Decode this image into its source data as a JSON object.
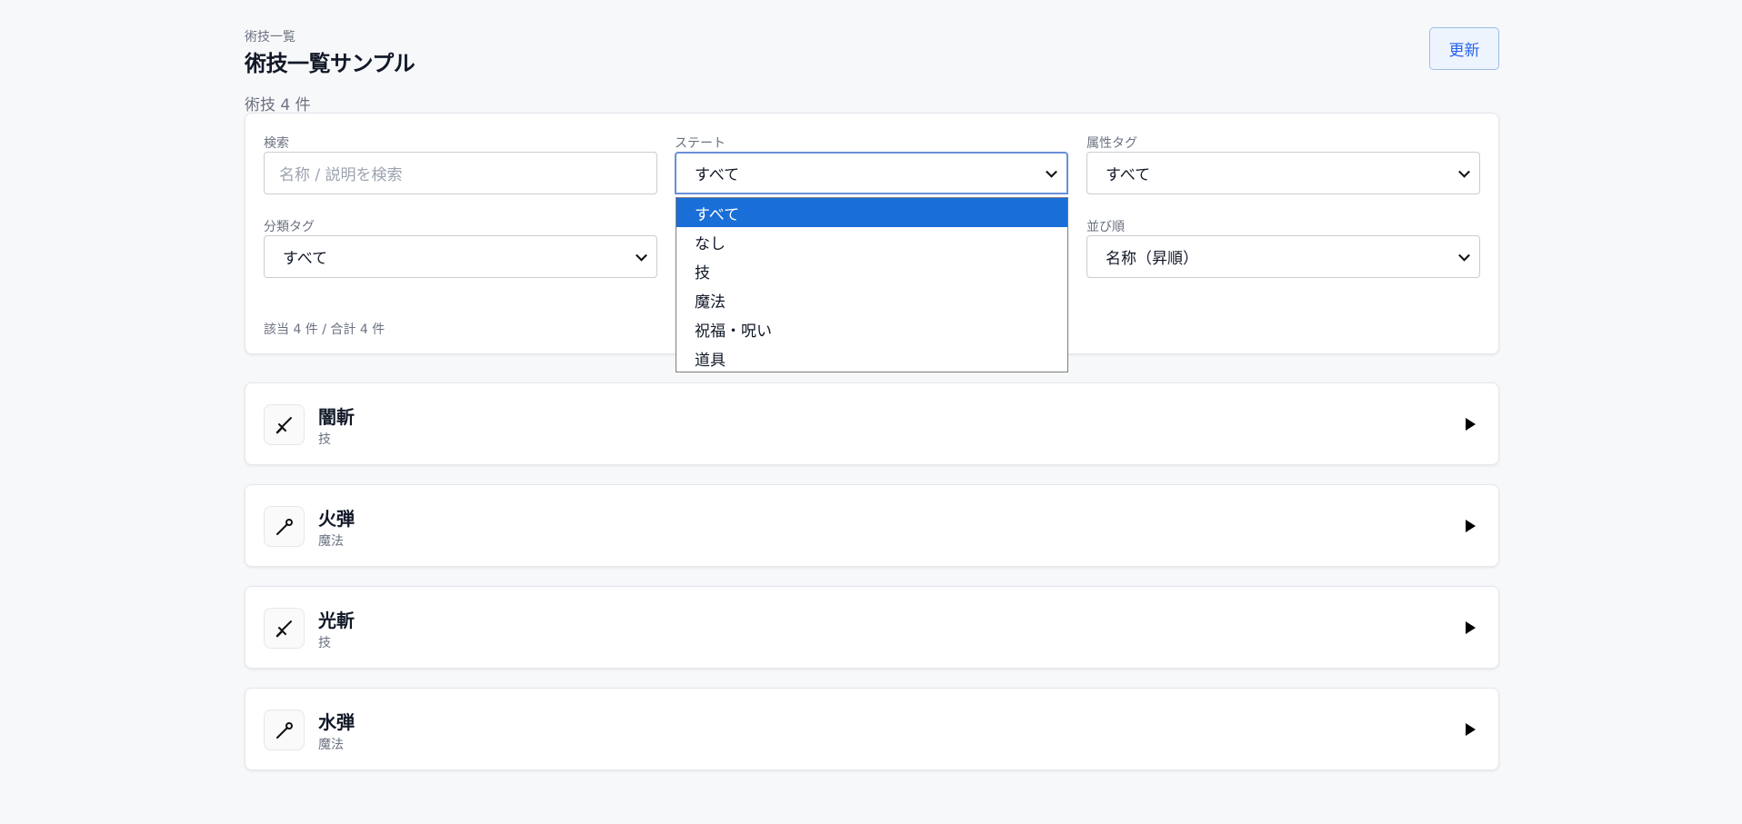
{
  "header": {
    "breadcrumb": "術技一覧",
    "title": "術技一覧サンプル",
    "refresh_label": "更新",
    "count_caption": "術技 4 件"
  },
  "filters": {
    "search": {
      "label": "検索",
      "placeholder": "名称 / 説明を検索",
      "value": ""
    },
    "state": {
      "label": "ステート",
      "value": "すべて"
    },
    "attribute_tag": {
      "label": "属性タグ",
      "value": "すべて"
    },
    "category_tag": {
      "label": "分類タグ",
      "value": "すべて"
    },
    "sort": {
      "label": "並び順",
      "value": "名称（昇順）"
    },
    "matched_text": "該当 4 件 / 合計 4 件"
  },
  "state_dropdown": {
    "open": true,
    "options": [
      "すべて",
      "なし",
      "技",
      "魔法",
      "祝福・呪い",
      "道具"
    ],
    "selected_index": 0
  },
  "items": [
    {
      "name": "闇斬",
      "type": "技",
      "icon": "sword-icon"
    },
    {
      "name": "火弾",
      "type": "魔法",
      "icon": "wand-icon"
    },
    {
      "name": "光斬",
      "type": "技",
      "icon": "sword-icon"
    },
    {
      "name": "水弾",
      "type": "魔法",
      "icon": "wand-icon"
    }
  ],
  "colors": {
    "accent": "#1a6ed8",
    "refresh_text": "#2563eb",
    "background": "#f7f8fa"
  }
}
